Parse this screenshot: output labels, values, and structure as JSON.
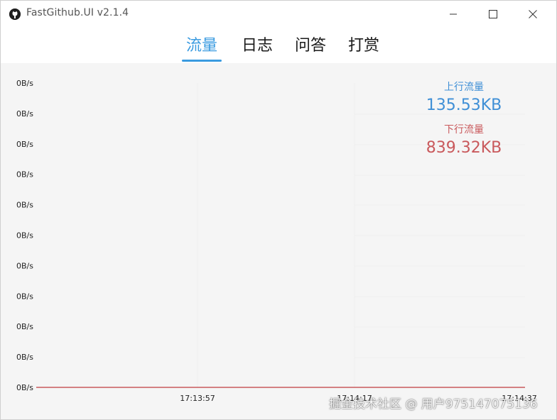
{
  "window": {
    "title": "FastGithub.UI v2.1.4",
    "icon": "github-cat-icon",
    "controls": [
      "minimize-icon",
      "maximize-icon",
      "close-icon"
    ]
  },
  "tabs": [
    {
      "label": "流量",
      "active": true
    },
    {
      "label": "日志",
      "active": false
    },
    {
      "label": "问答",
      "active": false
    },
    {
      "label": "打赏",
      "active": false
    }
  ],
  "stats": {
    "upload": {
      "label": "上行流量",
      "value": "135.53KB",
      "color": "#3f8fd6"
    },
    "download": {
      "label": "下行流量",
      "value": "839.32KB",
      "color": "#c9595c"
    }
  },
  "chart_data": {
    "type": "line",
    "x": [
      "17:13:57",
      "17:14:17",
      "17:14:37"
    ],
    "yticks": [
      "0B/s",
      "0B/s",
      "0B/s",
      "0B/s",
      "0B/s",
      "0B/s",
      "0B/s",
      "0B/s",
      "0B/s",
      "0B/s",
      "0B/s"
    ],
    "series": [
      {
        "values": [
          0,
          0,
          0
        ],
        "color": "#c9595c"
      }
    ],
    "grid": false,
    "background": "#f5f5f5"
  },
  "watermark": "掘金技术社区 @ 用户975147075136"
}
